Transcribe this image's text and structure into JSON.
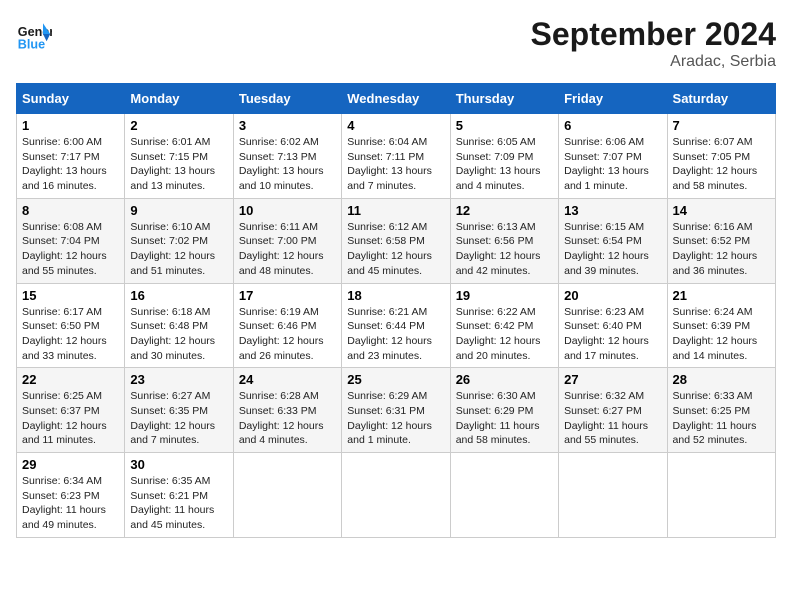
{
  "header": {
    "logo_general": "General",
    "logo_blue": "Blue",
    "month": "September 2024",
    "location": "Aradac, Serbia"
  },
  "weekdays": [
    "Sunday",
    "Monday",
    "Tuesday",
    "Wednesday",
    "Thursday",
    "Friday",
    "Saturday"
  ],
  "weeks": [
    [
      {
        "day": "1",
        "info": "Sunrise: 6:00 AM\nSunset: 7:17 PM\nDaylight: 13 hours\nand 16 minutes."
      },
      {
        "day": "2",
        "info": "Sunrise: 6:01 AM\nSunset: 7:15 PM\nDaylight: 13 hours\nand 13 minutes."
      },
      {
        "day": "3",
        "info": "Sunrise: 6:02 AM\nSunset: 7:13 PM\nDaylight: 13 hours\nand 10 minutes."
      },
      {
        "day": "4",
        "info": "Sunrise: 6:04 AM\nSunset: 7:11 PM\nDaylight: 13 hours\nand 7 minutes."
      },
      {
        "day": "5",
        "info": "Sunrise: 6:05 AM\nSunset: 7:09 PM\nDaylight: 13 hours\nand 4 minutes."
      },
      {
        "day": "6",
        "info": "Sunrise: 6:06 AM\nSunset: 7:07 PM\nDaylight: 13 hours\nand 1 minute."
      },
      {
        "day": "7",
        "info": "Sunrise: 6:07 AM\nSunset: 7:05 PM\nDaylight: 12 hours\nand 58 minutes."
      }
    ],
    [
      {
        "day": "8",
        "info": "Sunrise: 6:08 AM\nSunset: 7:04 PM\nDaylight: 12 hours\nand 55 minutes."
      },
      {
        "day": "9",
        "info": "Sunrise: 6:10 AM\nSunset: 7:02 PM\nDaylight: 12 hours\nand 51 minutes."
      },
      {
        "day": "10",
        "info": "Sunrise: 6:11 AM\nSunset: 7:00 PM\nDaylight: 12 hours\nand 48 minutes."
      },
      {
        "day": "11",
        "info": "Sunrise: 6:12 AM\nSunset: 6:58 PM\nDaylight: 12 hours\nand 45 minutes."
      },
      {
        "day": "12",
        "info": "Sunrise: 6:13 AM\nSunset: 6:56 PM\nDaylight: 12 hours\nand 42 minutes."
      },
      {
        "day": "13",
        "info": "Sunrise: 6:15 AM\nSunset: 6:54 PM\nDaylight: 12 hours\nand 39 minutes."
      },
      {
        "day": "14",
        "info": "Sunrise: 6:16 AM\nSunset: 6:52 PM\nDaylight: 12 hours\nand 36 minutes."
      }
    ],
    [
      {
        "day": "15",
        "info": "Sunrise: 6:17 AM\nSunset: 6:50 PM\nDaylight: 12 hours\nand 33 minutes."
      },
      {
        "day": "16",
        "info": "Sunrise: 6:18 AM\nSunset: 6:48 PM\nDaylight: 12 hours\nand 30 minutes."
      },
      {
        "day": "17",
        "info": "Sunrise: 6:19 AM\nSunset: 6:46 PM\nDaylight: 12 hours\nand 26 minutes."
      },
      {
        "day": "18",
        "info": "Sunrise: 6:21 AM\nSunset: 6:44 PM\nDaylight: 12 hours\nand 23 minutes."
      },
      {
        "day": "19",
        "info": "Sunrise: 6:22 AM\nSunset: 6:42 PM\nDaylight: 12 hours\nand 20 minutes."
      },
      {
        "day": "20",
        "info": "Sunrise: 6:23 AM\nSunset: 6:40 PM\nDaylight: 12 hours\nand 17 minutes."
      },
      {
        "day": "21",
        "info": "Sunrise: 6:24 AM\nSunset: 6:39 PM\nDaylight: 12 hours\nand 14 minutes."
      }
    ],
    [
      {
        "day": "22",
        "info": "Sunrise: 6:25 AM\nSunset: 6:37 PM\nDaylight: 12 hours\nand 11 minutes."
      },
      {
        "day": "23",
        "info": "Sunrise: 6:27 AM\nSunset: 6:35 PM\nDaylight: 12 hours\nand 7 minutes."
      },
      {
        "day": "24",
        "info": "Sunrise: 6:28 AM\nSunset: 6:33 PM\nDaylight: 12 hours\nand 4 minutes."
      },
      {
        "day": "25",
        "info": "Sunrise: 6:29 AM\nSunset: 6:31 PM\nDaylight: 12 hours\nand 1 minute."
      },
      {
        "day": "26",
        "info": "Sunrise: 6:30 AM\nSunset: 6:29 PM\nDaylight: 11 hours\nand 58 minutes."
      },
      {
        "day": "27",
        "info": "Sunrise: 6:32 AM\nSunset: 6:27 PM\nDaylight: 11 hours\nand 55 minutes."
      },
      {
        "day": "28",
        "info": "Sunrise: 6:33 AM\nSunset: 6:25 PM\nDaylight: 11 hours\nand 52 minutes."
      }
    ],
    [
      {
        "day": "29",
        "info": "Sunrise: 6:34 AM\nSunset: 6:23 PM\nDaylight: 11 hours\nand 49 minutes."
      },
      {
        "day": "30",
        "info": "Sunrise: 6:35 AM\nSunset: 6:21 PM\nDaylight: 11 hours\nand 45 minutes."
      },
      {
        "day": "",
        "info": ""
      },
      {
        "day": "",
        "info": ""
      },
      {
        "day": "",
        "info": ""
      },
      {
        "day": "",
        "info": ""
      },
      {
        "day": "",
        "info": ""
      }
    ]
  ]
}
